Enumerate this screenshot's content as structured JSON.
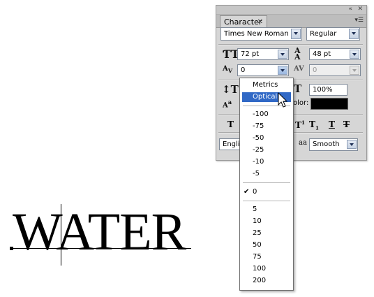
{
  "canvas": {
    "word": "WATER"
  },
  "panel": {
    "tab_label": "Character",
    "font_family": "Times New Roman",
    "font_style": "Regular",
    "font_size": "72 pt",
    "leading": "48 pt",
    "kerning_value": "0",
    "tracking_value": "0",
    "horizontal_scale": "100%",
    "color_label": "olor:",
    "language_partial": "Englis",
    "antialias": "Smooth",
    "antialias_icon": "aa",
    "colors": {
      "text_color": "#000000",
      "highlight": "#3169c6"
    }
  },
  "dropdown": {
    "top_options": [
      "Metrics",
      "Optical"
    ],
    "selected": "Optical",
    "negative_values": [
      "-100",
      "-75",
      "-50",
      "-25",
      "-10",
      "-5"
    ],
    "zero_value": "0",
    "positive_values": [
      "5",
      "10",
      "25",
      "50",
      "75",
      "100",
      "200"
    ]
  }
}
